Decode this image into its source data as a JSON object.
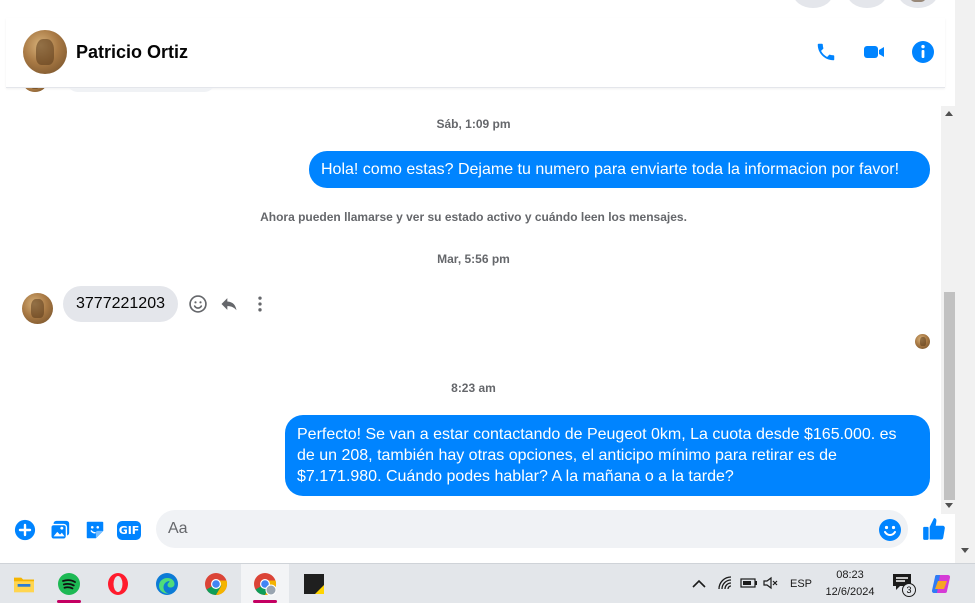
{
  "contact": {
    "name": "Patricio Ortiz"
  },
  "messages": {
    "ts1": "Sáb, 1:09 pm",
    "out1": "Hola! como estas? Dejame tu numero para enviarte toda la informacion por favor!",
    "notice": "Ahora pueden llamarse y ver su estado activo y cuándo leen los mensajes.",
    "ts2": "Mar, 5:56 pm",
    "in1": "3777221203",
    "ts3": "8:23 am",
    "out2": "Perfecto!  Se van a estar contactando de Peugeot 0km, La cuota desde $165.000. es de un 208, también hay otras opciones, el anticipo mínimo para retirar es de $7.171.980. Cuándo podes hablar? A la mañana o a la tarde?"
  },
  "composer": {
    "placeholder": "Aa",
    "gif_label": "GIF"
  },
  "taskbar": {
    "language": "ESP",
    "time": "08:23",
    "date": "12/6/2024",
    "notification_count": "3"
  },
  "colors": {
    "accent": "#0084ff",
    "incoming": "#e4e6eb"
  }
}
